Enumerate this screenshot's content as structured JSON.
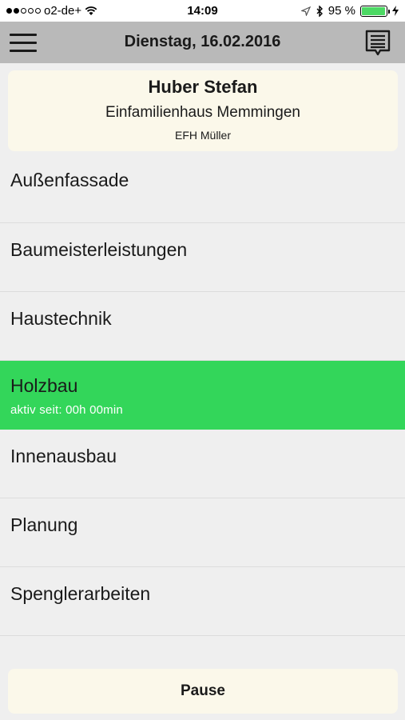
{
  "status": {
    "carrier": "o2-de+",
    "time": "14:09",
    "battery_percent": "95 %",
    "battery_level": 0.95,
    "signal_bars_filled": 2,
    "signal_bars_total": 5
  },
  "header": {
    "title": "Dienstag, 16.02.2016",
    "menu_icon": "hamburger-menu-icon",
    "notes_icon": "notes-list-icon"
  },
  "project": {
    "client": "Huber Stefan",
    "name": "Einfamilienhaus Memmingen",
    "subtitle": "EFH Müller"
  },
  "tasks": [
    {
      "label": "Außenfassade"
    },
    {
      "label": "Baumeisterleistungen"
    },
    {
      "label": "Haustechnik"
    },
    {
      "label": "Holzbau",
      "status": "aktiv seit: 00h 00min",
      "active": true
    },
    {
      "label": "Innenausbau"
    },
    {
      "label": "Planung"
    },
    {
      "label": "Spenglerarbeiten"
    }
  ],
  "colors": {
    "active": "#33d65a",
    "card": "#fbf8ea",
    "navbar": "#b9b9b9"
  },
  "pause_label": "Pause"
}
